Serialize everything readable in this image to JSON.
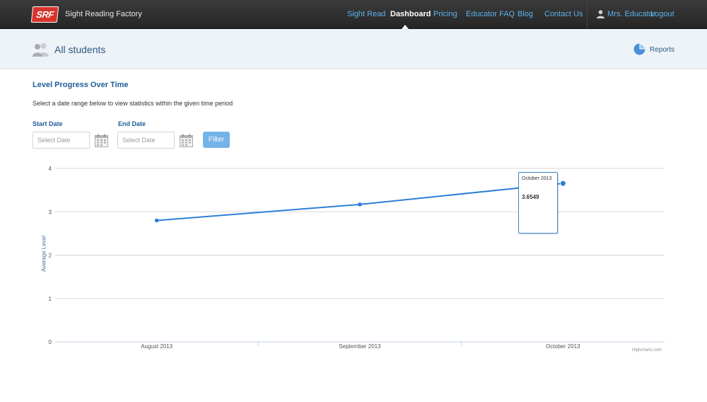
{
  "brand": {
    "logo_text": "SRF",
    "name": "Sight Reading Factory"
  },
  "nav": {
    "items": [
      "Sight Read",
      "Dashboard",
      "Pricing",
      "Educator FAQ",
      "Blog",
      "Contact Us"
    ],
    "active": "Dashboard",
    "user": "Mrs. Educator",
    "logout": "Logout"
  },
  "header": {
    "title": "All students",
    "reports_label": "Reports"
  },
  "filters": {
    "section_title": "Level Progress Over Time",
    "instructions": "Select a date range below to view statistics within the given time period",
    "start_label": "Start Date",
    "start_placeholder": "Select Date",
    "end_label": "End Date",
    "end_placeholder": "Select Date",
    "filter_button": "Filter"
  },
  "chart_data": {
    "type": "line",
    "categories": [
      "August 2013",
      "September 2013",
      "October 2013"
    ],
    "series": [
      {
        "values": [
          2.8,
          3.17,
          3.6549
        ],
        "color": "#2f7ed8"
      }
    ],
    "ylabel": "Average Level",
    "ylim": [
      0,
      4
    ],
    "yticks": [
      "0",
      "1",
      "2",
      "3",
      "4"
    ],
    "grid": true,
    "tooltip": {
      "label": "October 2013",
      "value": "3.6549"
    },
    "credit": "Highcharts.com"
  }
}
